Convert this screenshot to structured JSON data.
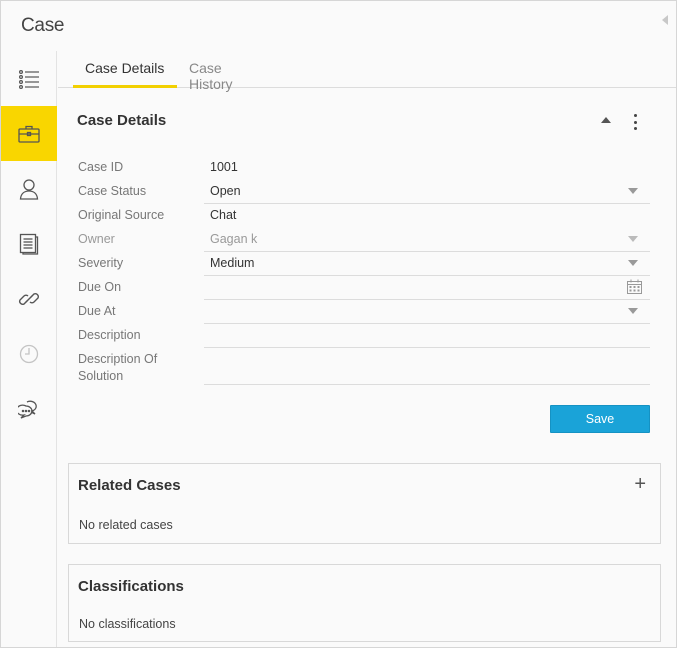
{
  "window": {
    "title": "Case"
  },
  "sidebar": {
    "items": [
      {
        "icon": "list-icon",
        "active": false
      },
      {
        "icon": "briefcase-icon",
        "active": true
      },
      {
        "icon": "user-icon",
        "active": false
      },
      {
        "icon": "document-icon",
        "active": false
      },
      {
        "icon": "link-icon",
        "active": false
      },
      {
        "icon": "clock-icon",
        "active": false
      },
      {
        "icon": "chat-bubbles-icon",
        "active": false
      }
    ],
    "active_color": "#f9d600"
  },
  "tabs": [
    {
      "label": "Case Details",
      "active": true
    },
    {
      "label": "Case History",
      "active": false
    }
  ],
  "details": {
    "title": "Case Details",
    "fields": [
      {
        "label": "Case ID",
        "value": "1001"
      },
      {
        "label": "Case Status",
        "value": "Open"
      },
      {
        "label": "Original Source",
        "value": "Chat"
      },
      {
        "label": "Owner",
        "value": "Gagan k"
      },
      {
        "label": "Severity",
        "value": "Medium"
      },
      {
        "label": "Due On",
        "value": ""
      },
      {
        "label": "Due At",
        "value": ""
      },
      {
        "label": "Description",
        "value": ""
      },
      {
        "label": "Description Of Solution",
        "value": ""
      }
    ],
    "save_label": "Save"
  },
  "related": {
    "title": "Related Cases",
    "empty": "No related cases"
  },
  "classifications": {
    "title": "Classifications",
    "empty": "No classifications"
  },
  "colors": {
    "accent": "#f9d600",
    "button": "#1aa3d8"
  }
}
